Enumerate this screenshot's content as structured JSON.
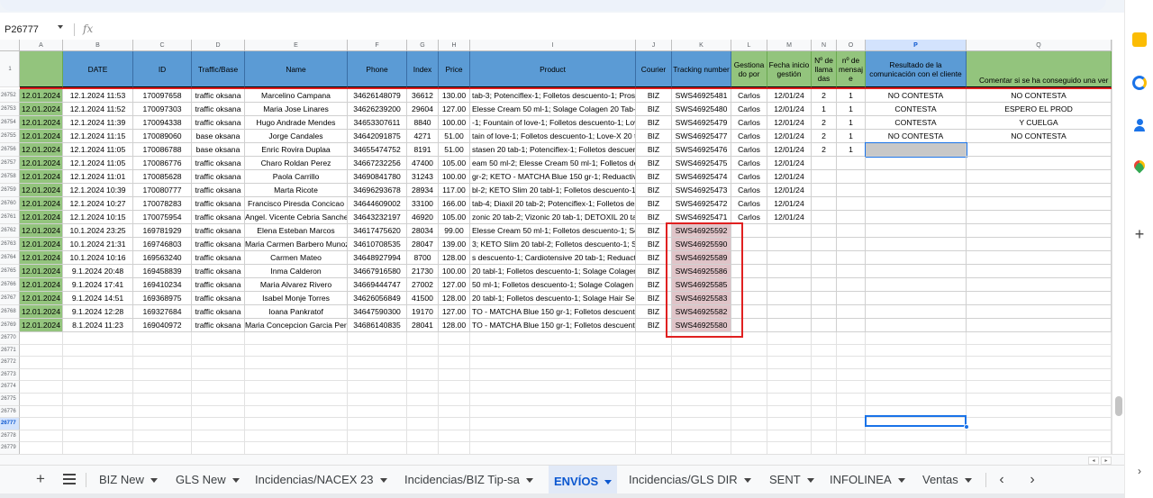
{
  "formula_bar": {
    "name_box": "P26777",
    "fx": "fx"
  },
  "columns": [
    {
      "letter": "A",
      "header": ""
    },
    {
      "letter": "B",
      "header": "DATE"
    },
    {
      "letter": "C",
      "header": "ID"
    },
    {
      "letter": "D",
      "header": "Traffic/Base"
    },
    {
      "letter": "E",
      "header": "Name"
    },
    {
      "letter": "F",
      "header": "Phone"
    },
    {
      "letter": "G",
      "header": "Index"
    },
    {
      "letter": "H",
      "header": "Price"
    },
    {
      "letter": "I",
      "header": "Product"
    },
    {
      "letter": "J",
      "header": "Courier"
    },
    {
      "letter": "K",
      "header": "Tracking number"
    },
    {
      "letter": "L",
      "header": "Gestiona do por"
    },
    {
      "letter": "M",
      "header": "Fecha inicio gestión"
    },
    {
      "letter": "N",
      "header": "Nº de llama das"
    },
    {
      "letter": "O",
      "header": "nº de mensaj e"
    },
    {
      "letter": "P",
      "header": "Resultado de la comunicación con el cliente"
    },
    {
      "letter": "Q",
      "header": "Comentar si se ha conseguido una ver"
    }
  ],
  "header_row_number": "1",
  "rows": [
    {
      "num": "26752",
      "date": "12.01.2024",
      "dt": "12.1.2024 11:53",
      "id": "170097658",
      "traffic": "traffic oksana",
      "name": "Marcelino Campana",
      "phone": "34626148079",
      "index": "36612",
      "price": "130.00",
      "product": "tab-3; Potenciflex-1; Folletos descuento-1; Prosta",
      "courier": "BIZ",
      "track": "SWS46925481",
      "gest": "Carlos",
      "fecha": "12/01/24",
      "llam": "2",
      "mens": "1",
      "res": "NO CONTESTA",
      "com": "NO CONTESTA"
    },
    {
      "num": "26753",
      "date": "12.01.2024",
      "dt": "12.1.2024 11:52",
      "id": "170097303",
      "traffic": "traffic oksana",
      "name": "Maria Jose Linares",
      "phone": "34626239200",
      "index": "29604",
      "price": "127.00",
      "product": "Elesse Cream 50 ml-1; Solage Colagen 20 Tab-1;",
      "courier": "BIZ",
      "track": "SWS46925480",
      "gest": "Carlos",
      "fecha": "12/01/24",
      "llam": "1",
      "mens": "1",
      "res": "CONTESTA",
      "com": "ESPERO EL PROD"
    },
    {
      "num": "26754",
      "date": "12.01.2024",
      "dt": "12.1.2024 11:39",
      "id": "170094338",
      "traffic": "traffic oksana",
      "name": "Hugo Andrade Mendes",
      "phone": "34653307611",
      "index": "8840",
      "price": "100.00",
      "product": "-1; Fountain of love-1; Folletos descuento-1; Lov",
      "courier": "BIZ",
      "track": "SWS46925479",
      "gest": "Carlos",
      "fecha": "12/01/24",
      "llam": "2",
      "mens": "1",
      "res": "CONTESTA",
      "com": "Y CUELGA"
    },
    {
      "num": "26755",
      "date": "12.01.2024",
      "dt": "12.1.2024 11:15",
      "id": "170089060",
      "traffic": "base oksana",
      "name": "Jorge Candales",
      "phone": "34642091875",
      "index": "4271",
      "price": "51.00",
      "product": "tain of love-1; Folletos descuento-1; Love-X 20 t",
      "courier": "BIZ",
      "track": "SWS46925477",
      "gest": "Carlos",
      "fecha": "12/01/24",
      "llam": "2",
      "mens": "1",
      "res": "NO CONTESTA",
      "com": "NO CONTESTA"
    },
    {
      "num": "26756",
      "date": "12.01.2024",
      "dt": "12.1.2024 11:05",
      "id": "170086788",
      "traffic": "base oksana",
      "name": "Enric Rovira Duplaa",
      "phone": "34655474752",
      "index": "8191",
      "price": "51.00",
      "product": "stasen 20 tab-1; Potenciflex-1; Folletos descuent",
      "courier": "BIZ",
      "track": "SWS46925476",
      "gest": "Carlos",
      "fecha": "12/01/24",
      "llam": "2",
      "mens": "1",
      "res": "",
      "com": ""
    },
    {
      "num": "26757",
      "date": "12.01.2024",
      "dt": "12.1.2024 11:05",
      "id": "170086776",
      "traffic": "traffic oksana",
      "name": "Charo Roldan Perez",
      "phone": "34667232256",
      "index": "47400",
      "price": "105.00",
      "product": "eam 50 ml-2; Elesse Cream 50 ml-1; Folletos des",
      "courier": "BIZ",
      "track": "SWS46925475",
      "gest": "Carlos",
      "fecha": "12/01/24",
      "llam": "",
      "mens": "",
      "res": "",
      "com": ""
    },
    {
      "num": "26758",
      "date": "12.01.2024",
      "dt": "12.1.2024 11:01",
      "id": "170085628",
      "traffic": "traffic oksana",
      "name": "Paola Carrillo",
      "phone": "34690841780",
      "index": "31243",
      "price": "100.00",
      "product": "gr-2; KETO - MATCHA Blue 150 gr-1; Reduactive",
      "courier": "BIZ",
      "track": "SWS46925474",
      "gest": "Carlos",
      "fecha": "12/01/24",
      "llam": "",
      "mens": "",
      "res": "",
      "com": ""
    },
    {
      "num": "26759",
      "date": "12.01.2024",
      "dt": "12.1.2024 10:39",
      "id": "170080777",
      "traffic": "traffic oksana",
      "name": "Marta Ricote",
      "phone": "34696293678",
      "index": "28934",
      "price": "117.00",
      "product": "bl-2; KETO Slim 20 tabl-1; Folletos descuento-1;",
      "courier": "BIZ",
      "track": "SWS46925473",
      "gest": "Carlos",
      "fecha": "12/01/24",
      "llam": "",
      "mens": "",
      "res": "",
      "com": ""
    },
    {
      "num": "26760",
      "date": "12.01.2024",
      "dt": "12.1.2024 10:27",
      "id": "170078283",
      "traffic": "traffic oksana",
      "name": "Francisco Piresda Concicao",
      "phone": "34644609002",
      "index": "33100",
      "price": "166.00",
      "product": "tab-4; Diaxil 20 tab-2; Potenciflex-1; Folletos des",
      "courier": "BIZ",
      "track": "SWS46925472",
      "gest": "Carlos",
      "fecha": "12/01/24",
      "llam": "",
      "mens": "",
      "res": "",
      "com": ""
    },
    {
      "num": "26761",
      "date": "12.01.2024",
      "dt": "12.1.2024 10:15",
      "id": "170075954",
      "traffic": "traffic oksana",
      "name": "Angel. Vicente Cebria Sanchez",
      "phone": "34643232197",
      "index": "46920",
      "price": "105.00",
      "product": "zonic 20 tab-2; Vizonic 20 tab-1; DETOXIL 20 tab",
      "courier": "BIZ",
      "track": "SWS46925471",
      "gest": "Carlos",
      "fecha": "12/01/24",
      "llam": "",
      "mens": "",
      "res": "",
      "com": ""
    },
    {
      "num": "26762",
      "date": "12.01.2024",
      "dt": "10.1.2024 23:25",
      "id": "169781929",
      "traffic": "traffic oksana",
      "name": "Elena Esteban Marcos",
      "phone": "34617475620",
      "index": "28034",
      "price": "99.00",
      "product": "Elesse Cream 50 ml-1; Folletos descuento-1; So",
      "courier": "BIZ",
      "track": "SWS46925592",
      "gest": "",
      "fecha": "",
      "llam": "",
      "mens": "",
      "res": "",
      "com": ""
    },
    {
      "num": "26763",
      "date": "12.01.2024",
      "dt": "10.1.2024 21:31",
      "id": "169746803",
      "traffic": "traffic oksana",
      "name": "Maria Carmen Barbero Munoz",
      "phone": "34610708535",
      "index": "28047",
      "price": "139.00",
      "product": "3; KETO Slim 20 tabl-2; Folletos descuento-1; So",
      "courier": "BIZ",
      "track": "SWS46925590",
      "gest": "",
      "fecha": "",
      "llam": "",
      "mens": "",
      "res": "",
      "com": ""
    },
    {
      "num": "26764",
      "date": "12.01.2024",
      "dt": "10.1.2024 10:16",
      "id": "169563240",
      "traffic": "traffic oksana",
      "name": "Carmen Mateo",
      "phone": "34648927994",
      "index": "8700",
      "price": "128.00",
      "product": "s descuento-1; Cardiotensive 20 tab-1; Reduactiv",
      "courier": "BIZ",
      "track": "SWS46925589",
      "gest": "",
      "fecha": "",
      "llam": "",
      "mens": "",
      "res": "",
      "com": ""
    },
    {
      "num": "26765",
      "date": "12.01.2024",
      "dt": "9.1.2024 20:48",
      "id": "169458839",
      "traffic": "traffic oksana",
      "name": "Inma Calderon",
      "phone": "34667916580",
      "index": "21730",
      "price": "100.00",
      "product": "20 tabl-1; Folletos descuento-1; Solage Colagen",
      "courier": "BIZ",
      "track": "SWS46925586",
      "gest": "",
      "fecha": "",
      "llam": "",
      "mens": "",
      "res": "",
      "com": ""
    },
    {
      "num": "26766",
      "date": "12.01.2024",
      "dt": "9.1.2024 17:41",
      "id": "169410234",
      "traffic": "traffic oksana",
      "name": "Maria Alvarez Rivero",
      "phone": "34669444747",
      "index": "27002",
      "price": "127.00",
      "product": "50 ml-1; Folletos descuento-1; Solage Colagen 2",
      "courier": "BIZ",
      "track": "SWS46925585",
      "gest": "",
      "fecha": "",
      "llam": "",
      "mens": "",
      "res": "",
      "com": ""
    },
    {
      "num": "26767",
      "date": "12.01.2024",
      "dt": "9.1.2024 14:51",
      "id": "169368975",
      "traffic": "traffic oksana",
      "name": "Isabel Monje Torres",
      "phone": "34626056849",
      "index": "41500",
      "price": "128.00",
      "product": "20 tabl-1; Folletos descuento-1; Solage Hair Ser",
      "courier": "BIZ",
      "track": "SWS46925583",
      "gest": "",
      "fecha": "",
      "llam": "",
      "mens": "",
      "res": "",
      "com": ""
    },
    {
      "num": "26768",
      "date": "12.01.2024",
      "dt": "9.1.2024 12:28",
      "id": "169327684",
      "traffic": "traffic oksana",
      "name": "Ioana Pankratof",
      "phone": "34647590300",
      "index": "19170",
      "price": "127.00",
      "product": "TO - MATCHA Blue 150 gr-1; Folletos descuento-1;",
      "courier": "BIZ",
      "track": "SWS46925582",
      "gest": "",
      "fecha": "",
      "llam": "",
      "mens": "",
      "res": "",
      "com": ""
    },
    {
      "num": "26769",
      "date": "12.01.2024",
      "dt": "8.1.2024 11:23",
      "id": "169040972",
      "traffic": "traffic oksana",
      "name": "Maria Concepcion Garcia Perez",
      "phone": "34686140835",
      "index": "28041",
      "price": "128.00",
      "product": "TO - MATCHA Blue 150 gr-1; Folletos descuento",
      "courier": "BIZ",
      "track": "SWS46925580",
      "gest": "",
      "fecha": "",
      "llam": "",
      "mens": "",
      "res": "",
      "com": ""
    }
  ],
  "empty_rows": [
    "26770",
    "26771",
    "26772",
    "26773",
    "26774",
    "26775",
    "26776",
    "26777",
    "26778",
    "26779"
  ],
  "selected_row": "26777",
  "sheet_tabs": [
    {
      "label": "BIZ New"
    },
    {
      "label": "GLS New"
    },
    {
      "label": "Incidencias/NACEX 23"
    },
    {
      "label": "Incidencias/BIZ Tip-sa"
    },
    {
      "label": "ENVÍOS",
      "active": true
    },
    {
      "label": "Incidencias/GLS DIR"
    },
    {
      "label": "SENT"
    },
    {
      "label": "INFOLINEA"
    },
    {
      "label": "Ventas"
    }
  ],
  "colors": {
    "header_blue": "#5b9bd5",
    "header_green": "#93c47d",
    "tracking_highlight": "#e0c4c8",
    "annotation_red": "#e02020",
    "selection_blue": "#1a73e8"
  },
  "icons": {
    "add_sheet": "plus-icon",
    "all_sheets": "menu-icon",
    "scroll_left": "chevron-left-icon",
    "scroll_right": "chevron-right-icon"
  }
}
